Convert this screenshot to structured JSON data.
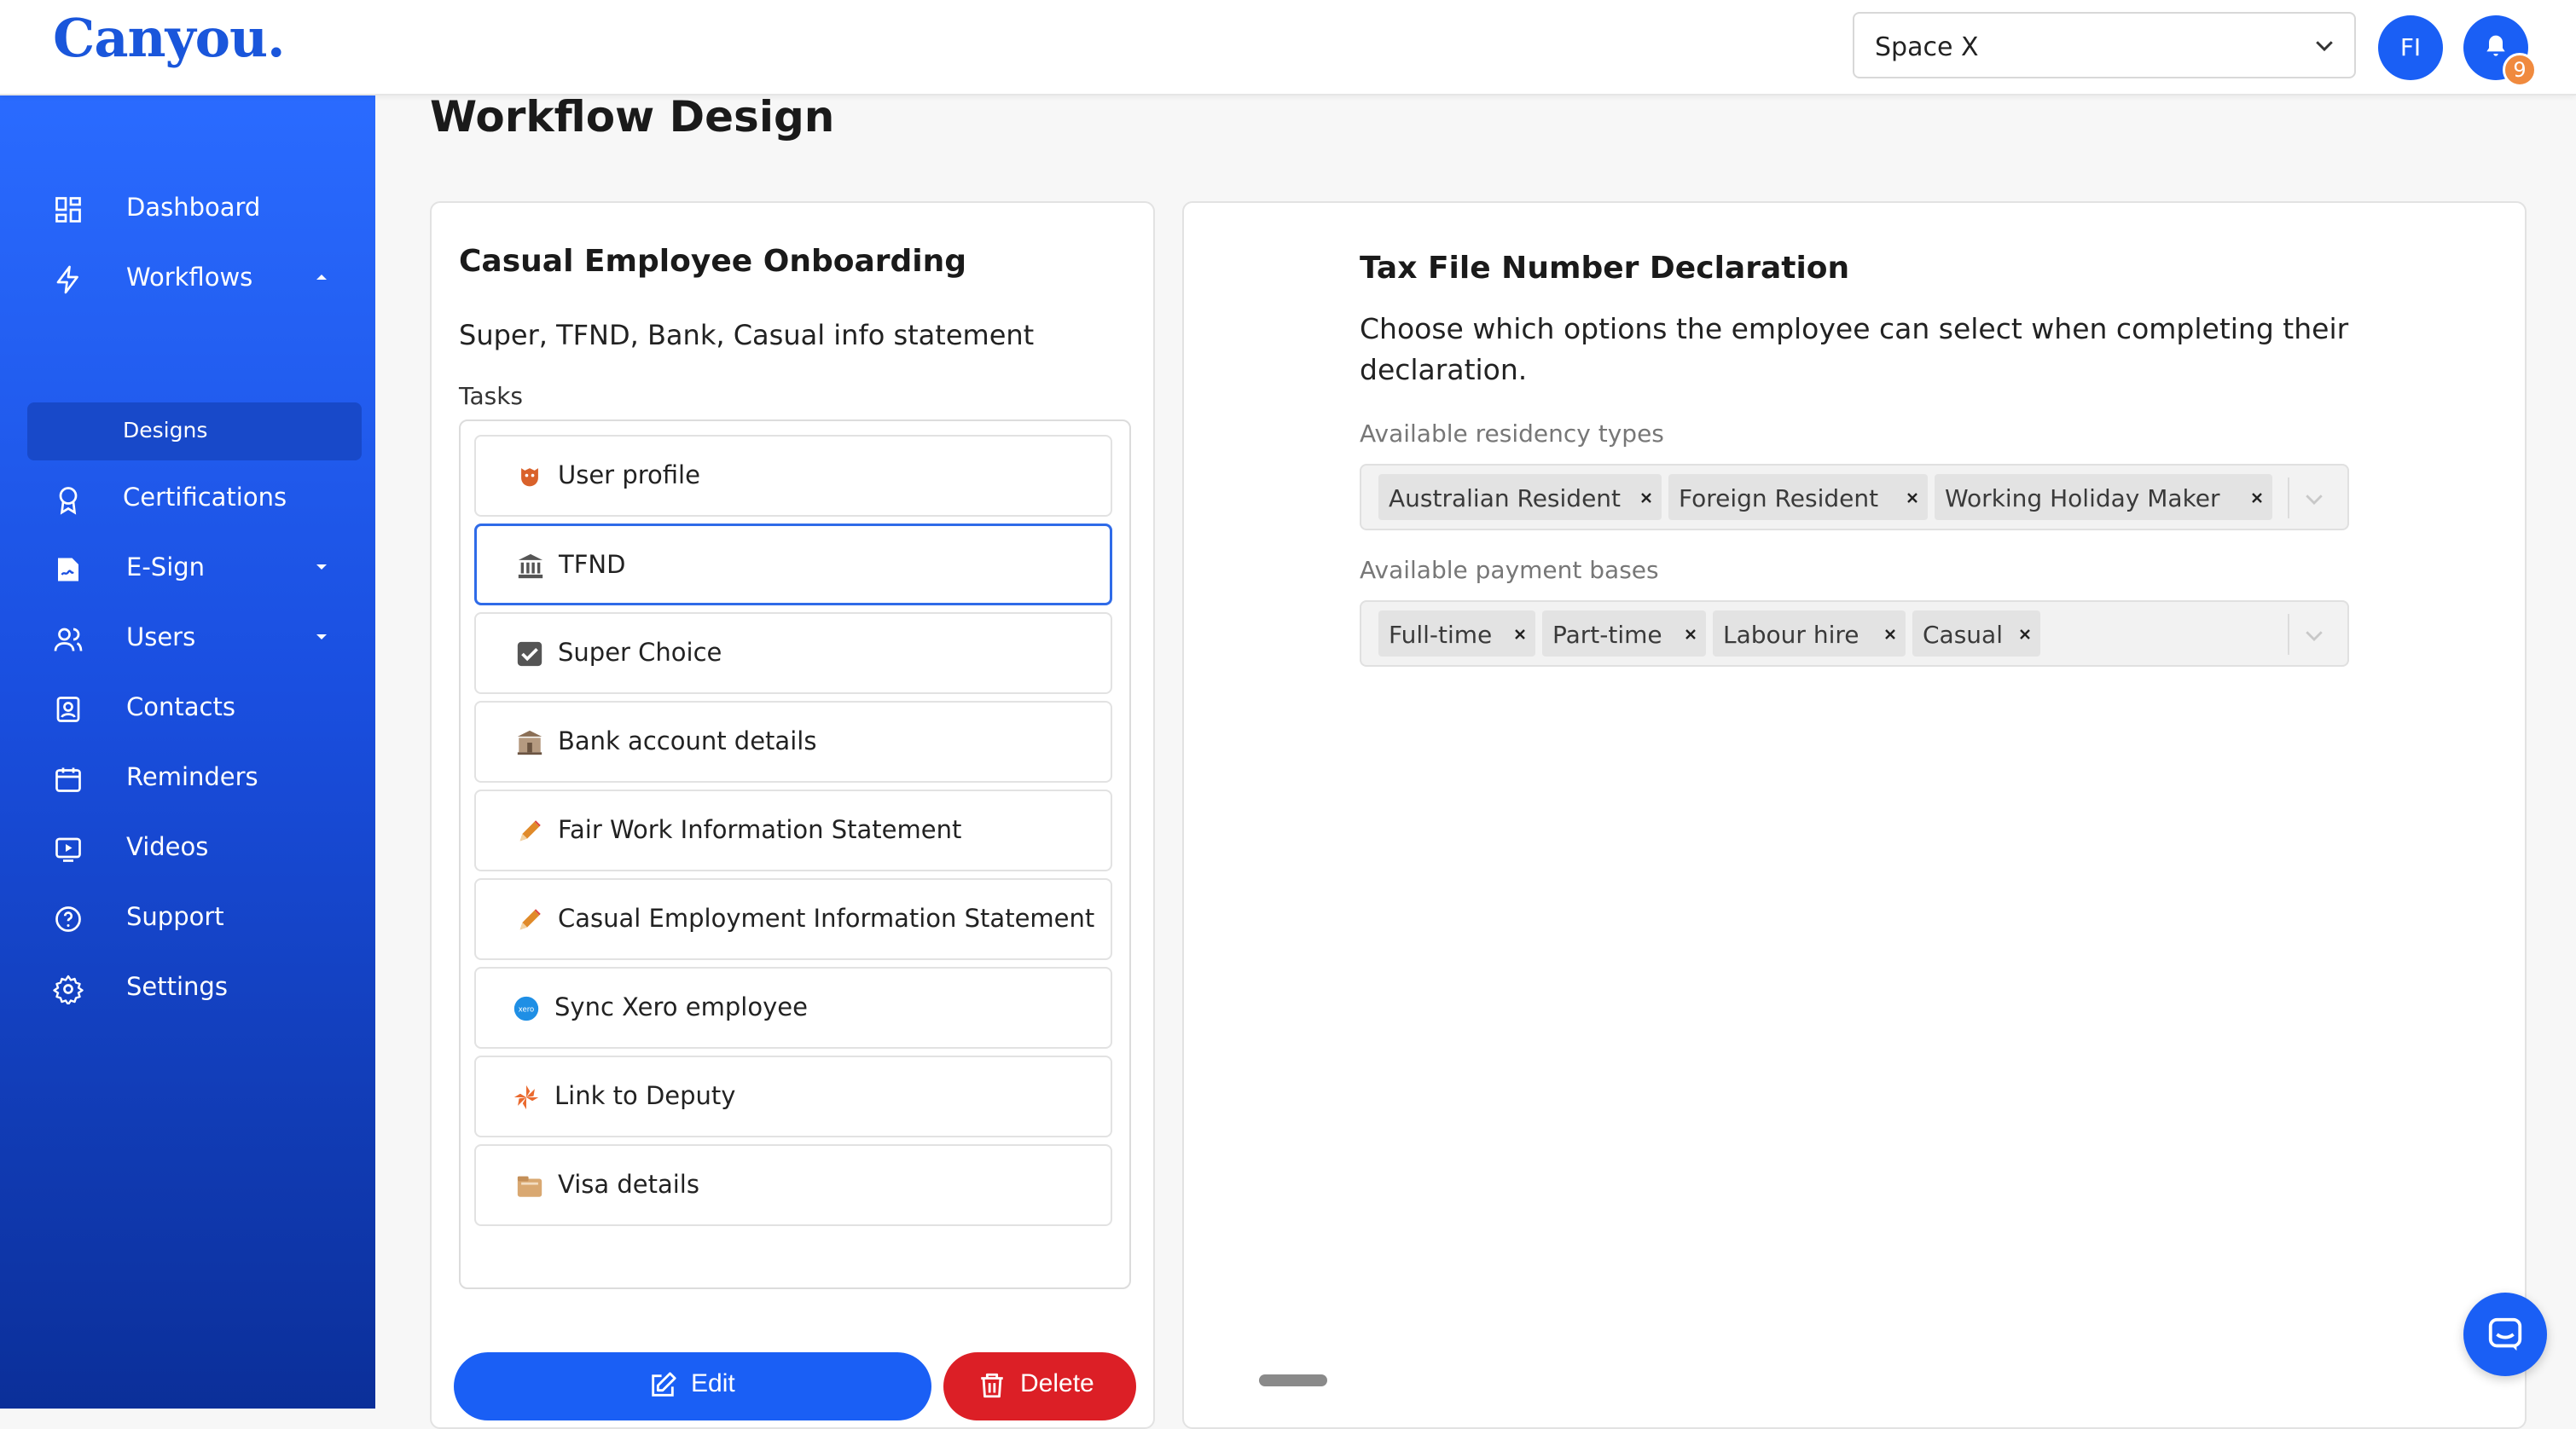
{
  "brand": {
    "logo_text": "Canyou."
  },
  "header": {
    "space_select_value": "Space X",
    "avatar_initials": "FI",
    "notification_count": "9"
  },
  "sidebar": {
    "items": [
      {
        "label": "Dashboard",
        "icon": "dashboard-icon"
      },
      {
        "label": "Workflows",
        "icon": "lightning-icon"
      },
      {
        "label": "Certifications",
        "icon": "award-icon"
      },
      {
        "label": "E-Sign",
        "icon": "signature-icon"
      },
      {
        "label": "Users",
        "icon": "users-icon"
      },
      {
        "label": "Contacts",
        "icon": "contacts-icon"
      },
      {
        "label": "Reminders",
        "icon": "calendar-icon"
      },
      {
        "label": "Videos",
        "icon": "video-icon"
      },
      {
        "label": "Support",
        "icon": "help-icon"
      },
      {
        "label": "Settings",
        "icon": "gear-icon"
      }
    ],
    "sub_item_label": "Designs"
  },
  "page": {
    "title": "Workflow Design"
  },
  "workflow": {
    "title": "Casual Employee Onboarding",
    "description": "Super, TFND, Bank, Casual info statement",
    "tasks_label": "Tasks",
    "tasks": [
      {
        "label": "User profile",
        "icon": "user-profile-icon"
      },
      {
        "label": "TFND",
        "icon": "bank-building-icon"
      },
      {
        "label": "Super Choice",
        "icon": "checkbox-icon"
      },
      {
        "label": "Bank account details",
        "icon": "bank-icon"
      },
      {
        "label": "Fair Work Information Statement",
        "icon": "pencil-icon"
      },
      {
        "label": "Casual Employment Information Statement",
        "icon": "pencil-icon"
      },
      {
        "label": "Sync Xero employee",
        "icon": "xero-icon"
      },
      {
        "label": "Link to Deputy",
        "icon": "deputy-icon"
      },
      {
        "label": "Visa details",
        "icon": "folder-icon"
      }
    ],
    "edit_label": "Edit",
    "delete_label": "Delete"
  },
  "detail": {
    "title": "Tax File Number Declaration",
    "description": "Choose which options the employee can select when completing their declaration.",
    "residency_label": "Available residency types",
    "residency_types": [
      "Australian Resident",
      "Foreign Resident",
      "Working Holiday Maker"
    ],
    "payment_label": "Available payment bases",
    "payment_bases": [
      "Full-time",
      "Part-time",
      "Labour hire",
      "Casual"
    ]
  },
  "colors": {
    "primary": "#1a5ff5",
    "danger": "#dc1f26",
    "badge": "#f08a3e"
  }
}
